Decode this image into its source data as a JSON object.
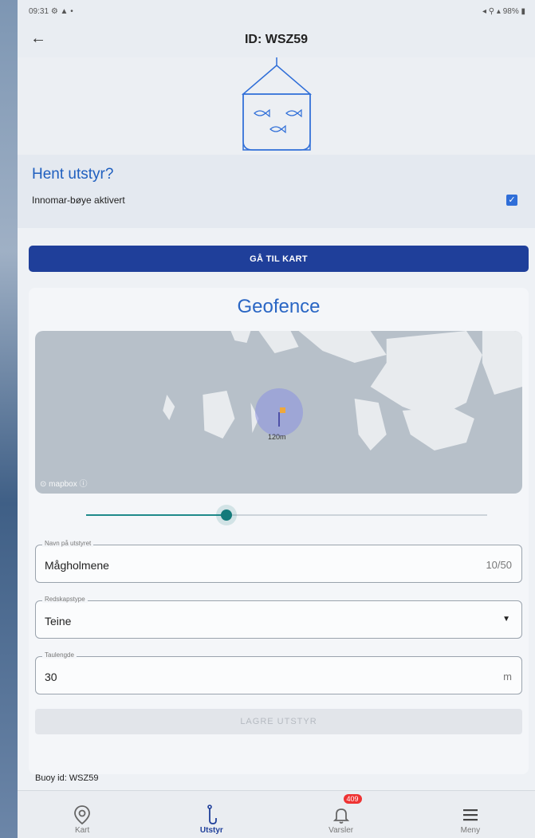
{
  "statusbar": {
    "time": "09:31",
    "left_icons": "⚙ ▲ •",
    "right_text": "98%"
  },
  "header": {
    "title": "ID: WSZ59"
  },
  "hent": {
    "title": "Hent utstyr?",
    "checkbox_label": "Innomar-bøye aktivert",
    "checked": true
  },
  "buttons": {
    "go_to_map": "GÅ TIL KART",
    "save": "LAGRE UTSTYR"
  },
  "geofence": {
    "title": "Geofence",
    "map_attribution": "mapbox",
    "radius_label": "120m",
    "slider_fraction": 0.36
  },
  "form": {
    "name": {
      "label": "Navn på utstyret",
      "value": "Mågholmene",
      "counter": "10/50"
    },
    "type": {
      "label": "Redskapstype",
      "value": "Teine"
    },
    "length": {
      "label": "Taulengde",
      "value": "30",
      "unit": "m"
    }
  },
  "buoy": {
    "text": "Buoy id: WSZ59"
  },
  "nav": {
    "items": [
      {
        "label": "Kart",
        "icon": "map-pin-icon"
      },
      {
        "label": "Utstyr",
        "icon": "hook-icon"
      },
      {
        "label": "Varsler",
        "icon": "bell-icon",
        "badge": "409"
      },
      {
        "label": "Meny",
        "icon": "menu-icon"
      }
    ]
  },
  "colors": {
    "primary": "#1f3f9a",
    "accent_blue": "#2a66c4",
    "slider": "#147a7a",
    "badge": "#e33333"
  }
}
